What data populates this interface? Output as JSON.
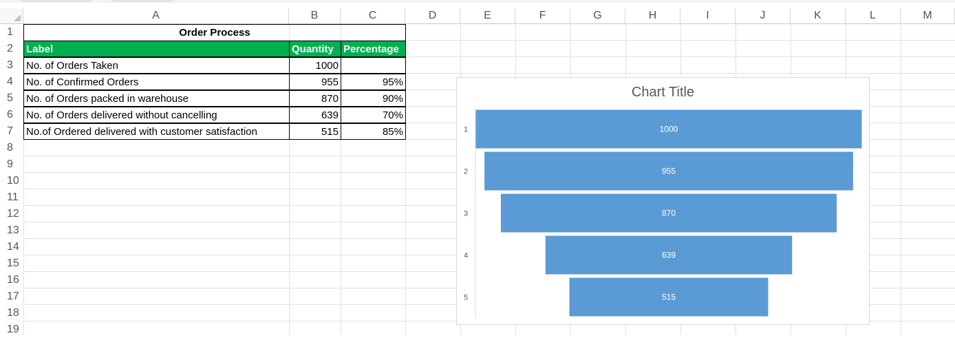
{
  "columns": [
    "A",
    "B",
    "C",
    "D",
    "E",
    "F",
    "G",
    "H",
    "I",
    "J",
    "K",
    "L",
    "M"
  ],
  "rows": [
    "1",
    "2",
    "3",
    "4",
    "5",
    "6",
    "7",
    "8",
    "9",
    "10",
    "11",
    "12",
    "13",
    "14",
    "15",
    "16",
    "17",
    "18",
    "19"
  ],
  "table": {
    "title": "Order Process",
    "headers": [
      "Label",
      "Quantity",
      "Percentage"
    ],
    "rows": [
      {
        "label": "No. of Orders Taken",
        "quantity": "1000",
        "percentage": ""
      },
      {
        "label": "No. of Confirmed Orders",
        "quantity": "955",
        "percentage": "95%"
      },
      {
        "label": "No. of Orders packed in warehouse",
        "quantity": "870",
        "percentage": "90%"
      },
      {
        "label": "No. of Orders delivered without cancelling",
        "quantity": "639",
        "percentage": "70%"
      },
      {
        "label": "No.of Ordered delivered with customer satisfaction",
        "quantity": "515",
        "percentage": "85%"
      }
    ]
  },
  "colors": {
    "header_fill": "#00b050",
    "bar": "#5b9bd5"
  },
  "chart_data": {
    "type": "bar",
    "variant": "funnel",
    "title": "Chart Title",
    "categories": [
      "1",
      "2",
      "3",
      "4",
      "5"
    ],
    "values": [
      1000,
      955,
      870,
      639,
      515
    ],
    "data_labels": [
      "1000",
      "955",
      "870",
      "639",
      "515"
    ],
    "legend": "none",
    "grid": false
  }
}
